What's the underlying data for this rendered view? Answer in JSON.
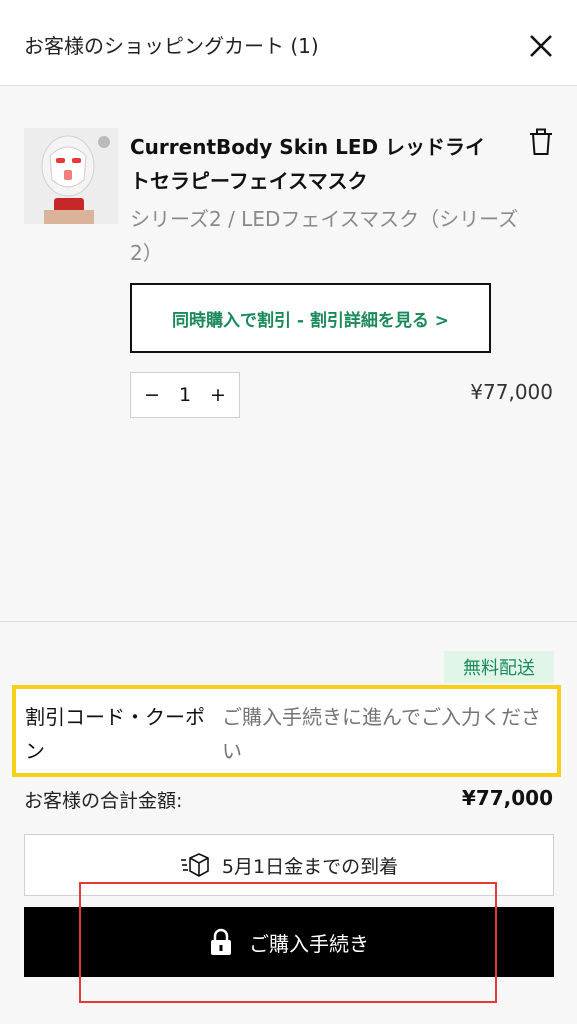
{
  "header": {
    "title": "お客様のショッピングカート (1)"
  },
  "item": {
    "name": "CurrentBody Skin LED レッドライトセラピーフェイスマスク",
    "variant": "シリーズ2 / LEDフェイスマスク（シリーズ2）",
    "bundle_link": "同時購入で割引 - 割引詳細を見る >",
    "quantity": "1",
    "qty_minus": "−",
    "qty_plus": "+",
    "price": "¥77,000"
  },
  "summary": {
    "free_shipping": "無料配送",
    "coupon_label": "割引コード・クーポン",
    "coupon_placeholder": "ご購入手続きに進んでご入力ください",
    "total_label": "お客様の合計金額:",
    "total_value": "¥77,000",
    "delivery": "5月1日金までの到着",
    "checkout": "ご購入手続き"
  },
  "icons": {
    "close": "close-icon",
    "trash": "trash-icon",
    "box": "box-icon",
    "lock": "lock-icon"
  },
  "colors": {
    "accent_green": "#1b8a5a",
    "free_shipping_bg": "#e1f5e9",
    "highlight_yellow": "#f7d117",
    "highlight_red": "#e53935",
    "checkout_bg": "#000000"
  }
}
